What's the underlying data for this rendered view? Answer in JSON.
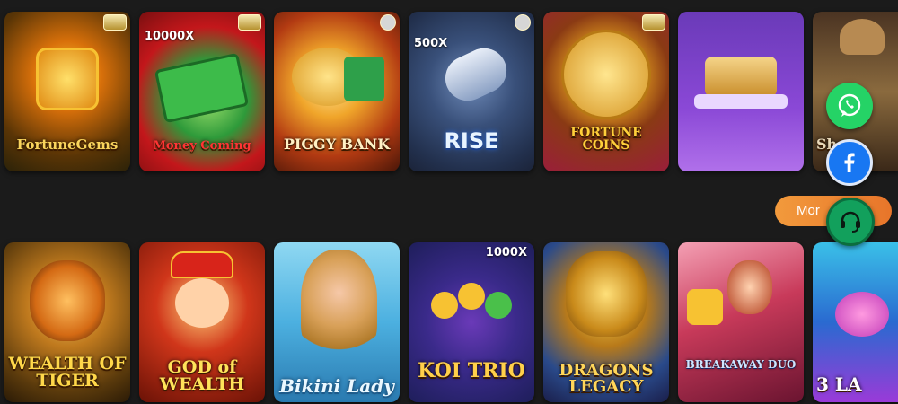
{
  "top_games": [
    {
      "id": "fortune-gems",
      "title": "FortuneGems",
      "tag": "",
      "badge": "gold"
    },
    {
      "id": "money-coming",
      "title": "Money Coming",
      "tag": "10000X",
      "badge": "gold"
    },
    {
      "id": "piggy-bank",
      "title": "PIGGY BANK",
      "tag": "",
      "badge": "round"
    },
    {
      "id": "crazy-rise",
      "title": "RISE",
      "tag": "500X",
      "badge": "round"
    },
    {
      "id": "fortune-coins",
      "title": "FORTUNE COINS",
      "tag": "",
      "badge": "gold"
    },
    {
      "id": "knight-slot",
      "title": "",
      "tag": "",
      "badge": ""
    },
    {
      "id": "showdown",
      "title": "Show",
      "tag": "",
      "badge": ""
    }
  ],
  "bottom_games": [
    {
      "id": "wealth-of-tiger",
      "title": "WEALTH OF TIGER",
      "tag": "",
      "badge": ""
    },
    {
      "id": "god-of-wealth",
      "title": "GOD of WEALTH",
      "tag": "",
      "badge": ""
    },
    {
      "id": "bikini-lady",
      "title": "Bikini Lady",
      "tag": "",
      "badge": ""
    },
    {
      "id": "koi-trio",
      "title": "KOI TRIO",
      "tag": "1000X",
      "badge": ""
    },
    {
      "id": "dragons-legacy",
      "title": "DRAGONS LEGACY",
      "tag": "",
      "badge": ""
    },
    {
      "id": "breakaway-duo",
      "title": "BREAKAWAY DUO",
      "tag": "",
      "badge": ""
    },
    {
      "id": "three-lady",
      "title": "3 LA",
      "tag": "",
      "badge": ""
    }
  ],
  "more_button": {
    "label": "Mor"
  },
  "colors": {
    "background": "#1b1b1b",
    "whatsapp": "#25d366",
    "facebook": "#1877f2",
    "support": "#12a05c",
    "more_button": "#ee852f"
  },
  "icons": {
    "whatsapp": "whatsapp-icon",
    "facebook": "facebook-icon",
    "support": "headset-icon"
  }
}
